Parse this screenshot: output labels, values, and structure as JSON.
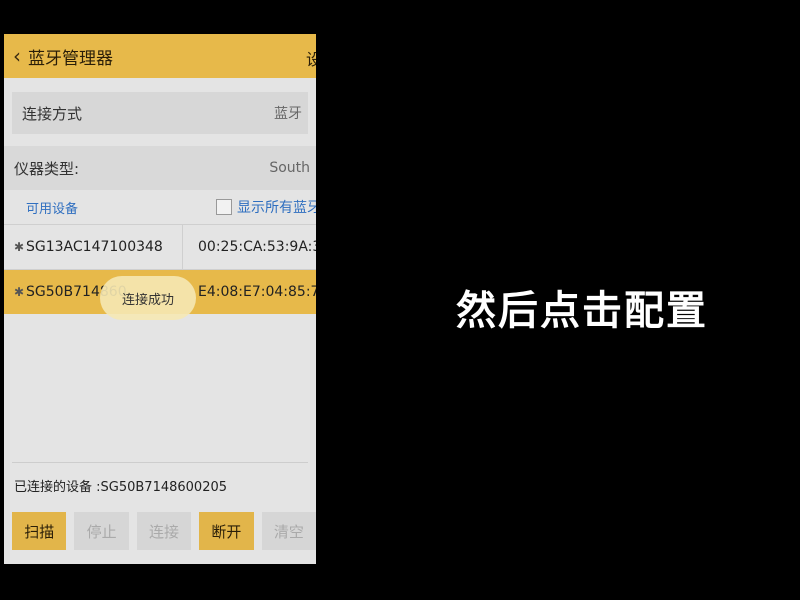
{
  "header": {
    "back_icon": "chevron-left-icon",
    "title": "蓝牙管理器",
    "right": "设"
  },
  "connection": {
    "label": "连接方式",
    "value": "蓝牙"
  },
  "instrument": {
    "label": "仪器类型:",
    "value": "South"
  },
  "available": {
    "label": "可用设备",
    "show_all": "显示所有蓝牙"
  },
  "devices": [
    {
      "name": "SG13AC147100348",
      "mac": "00:25:CA:53:9A:3("
    },
    {
      "name": "SG50B714860",
      "mac": "E4:08:E7:04:85:7"
    }
  ],
  "toast": "连接成功",
  "connected": "已连接的设备 :SG50B7148600205",
  "buttons": {
    "scan": "扫描",
    "stop": "停止",
    "connect": "连接",
    "disconnect": "断开",
    "clear": "清空"
  },
  "caption": "然后点击配置"
}
